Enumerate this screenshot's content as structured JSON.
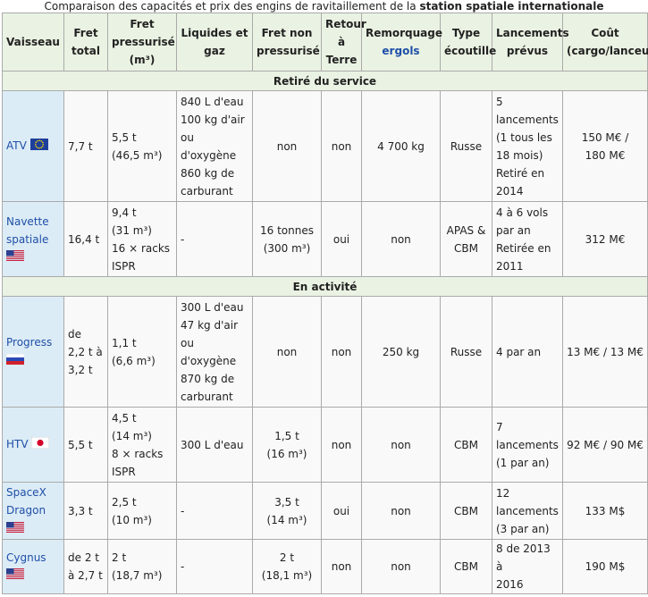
{
  "caption": {
    "prefix": "Comparaison des capacités et prix des engins de ravitaillement de la ",
    "bold": "station spatiale internationale"
  },
  "headers": {
    "vaisseau": "Vaisseau",
    "fret_total": "Fret total",
    "fret_press": "Fret pressurisé (m³)",
    "liquides": "Liquides et gaz",
    "fret_non_press": "Fret non pressurisé",
    "retour": "Retour à Terre",
    "remorquage": "Remorquage",
    "ergols": "ergols",
    "ecoutille": "Type écoutille",
    "lancements": "Lancements prévus",
    "cout": "Coût (cargo/lanceur)"
  },
  "sections": {
    "retired": "Retiré du service",
    "active": "En activité"
  },
  "rows": {
    "atv": {
      "name": "ATV",
      "flag": "eu-flag-icon",
      "fret_total": "7,7 t",
      "fret_press": [
        "5,5 t",
        "(46,5 m³)"
      ],
      "liquides": [
        "840 L d'eau",
        "100 kg d'air",
        "ou",
        "d'oxygène",
        "860 kg de",
        "carburant"
      ],
      "fret_non_press": "non",
      "retour": "non",
      "remorquage": "4 700 kg",
      "ecoutille": "Russe",
      "lancements": [
        "5",
        "lancements",
        "(1 tous les",
        "18 mois)",
        "Retiré en",
        "2014"
      ],
      "cout": [
        "150 M€ /",
        "180 M€"
      ]
    },
    "navette": {
      "name": [
        "Navette",
        "spatiale"
      ],
      "flag": "us-flag-icon",
      "fret_total": "16,4 t",
      "fret_press": [
        "9,4 t",
        "(31 m³)",
        "16 × racks",
        "ISPR"
      ],
      "liquides": "-",
      "fret_non_press": [
        "16 tonnes",
        "(300 m³)"
      ],
      "retour": "oui",
      "remorquage": "non",
      "ecoutille": [
        "APAS &",
        "CBM"
      ],
      "lancements": [
        "4 à 6 vols",
        "par an",
        "Retirée en",
        "2011"
      ],
      "cout": "312 M€"
    },
    "progress": {
      "name": "Progress",
      "flag": "russia-flag-icon",
      "fret_total": [
        "de",
        "2,2 t à",
        "3,2 t"
      ],
      "fret_press": [
        "1,1 t",
        "(6,6 m³)"
      ],
      "liquides": [
        "300 L d'eau",
        "47 kg d'air",
        "ou",
        "d'oxygène",
        "870 kg de",
        "carburant"
      ],
      "fret_non_press": "non",
      "retour": "non",
      "remorquage": "250 kg",
      "ecoutille": "Russe",
      "lancements": "4 par an",
      "cout": "13 M€ / 13 M€"
    },
    "htv": {
      "name": "HTV",
      "flag": "japan-flag-icon",
      "fret_total": "5,5 t",
      "fret_press": [
        "4,5 t",
        "(14 m³)",
        "8 × racks",
        "ISPR"
      ],
      "liquides": "300 L d'eau",
      "fret_non_press": [
        "1,5 t",
        "(16 m³)"
      ],
      "retour": "non",
      "remorquage": "non",
      "ecoutille": "CBM",
      "lancements": [
        "7",
        "lancements",
        "(1 par an)"
      ],
      "cout": "92 M€ / 90 M€"
    },
    "dragon": {
      "name": [
        "SpaceX",
        "Dragon"
      ],
      "flag": "us-flag-icon",
      "fret_total": "3,3 t",
      "fret_press": [
        "2,5 t",
        "(10 m³)"
      ],
      "liquides": "-",
      "fret_non_press": [
        "3,5 t",
        "(14 m³)"
      ],
      "retour": "oui",
      "remorquage": "non",
      "ecoutille": "CBM",
      "lancements": [
        "12",
        "lancements",
        "(3 par an)"
      ],
      "cout": "133 M$"
    },
    "cygnus": {
      "name": "Cygnus",
      "flag": "us-flag-icon",
      "fret_total": [
        "de 2 t",
        "à 2,7 t"
      ],
      "fret_press": [
        "2 t",
        "(18,7 m³)"
      ],
      "liquides": "-",
      "fret_non_press": [
        "2 t",
        "(18,1 m³)"
      ],
      "retour": "non",
      "remorquage": "non",
      "ecoutille": "CBM",
      "lancements": [
        "8 de 2013 à",
        "2016"
      ],
      "cout": "190 M$"
    }
  },
  "colors": {
    "header_bg": "#eaf3e3",
    "name_cell_bg": "#dcecf6",
    "cell_bg": "#f9f9f9",
    "border": "#aaaaaa",
    "link": "#1f4fa8"
  }
}
